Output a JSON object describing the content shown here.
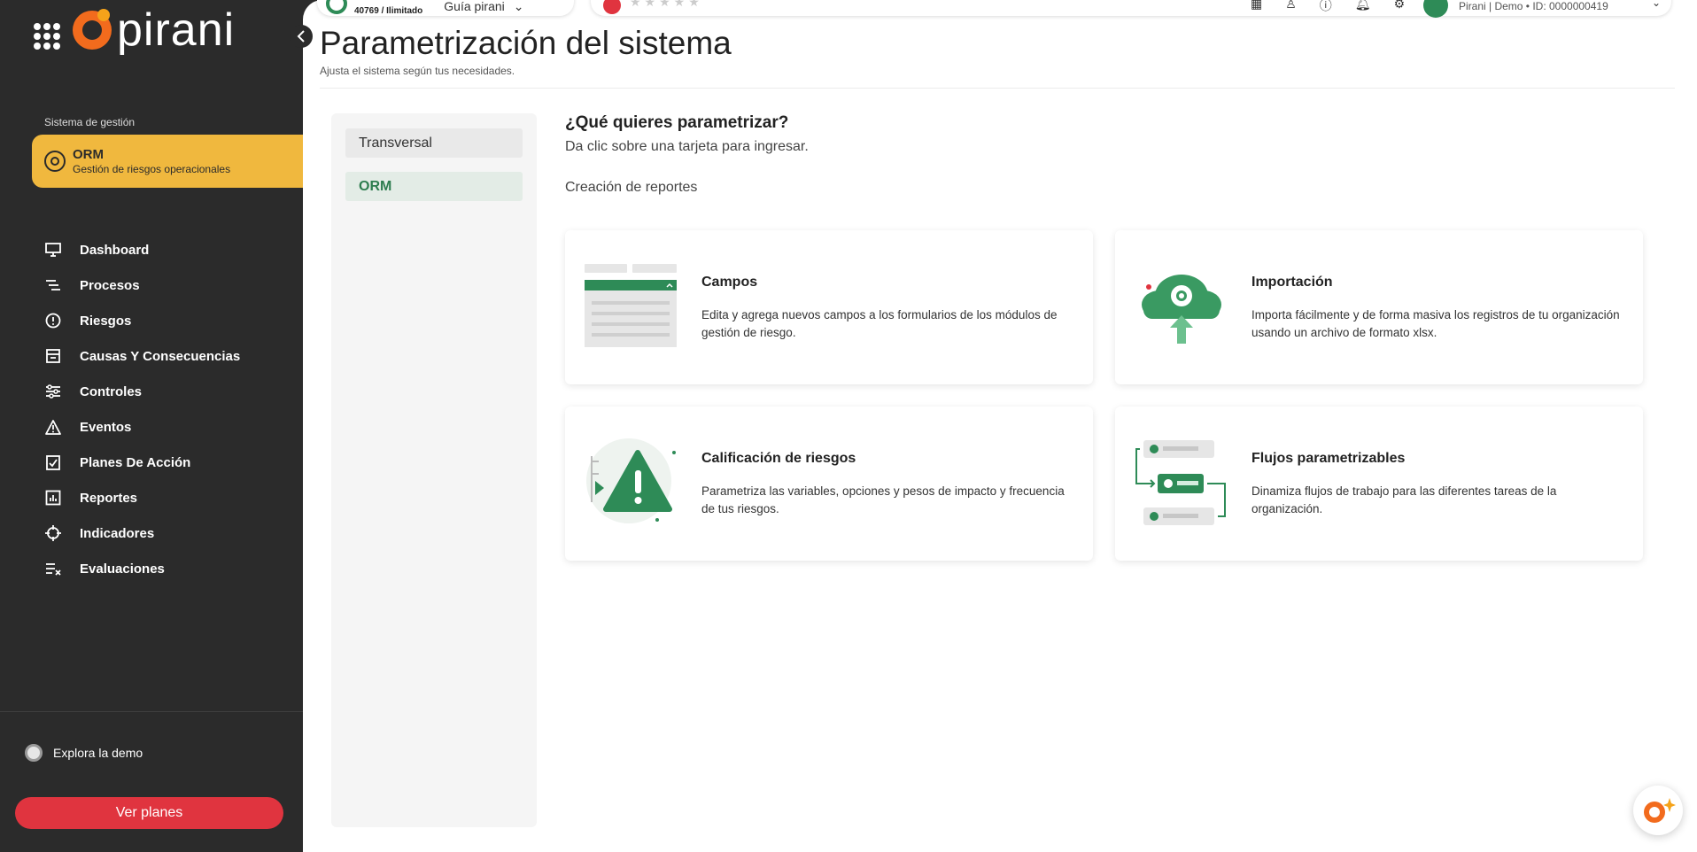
{
  "brand": {
    "name": "pirani"
  },
  "sidebar": {
    "system_label": "Sistema de gestión",
    "module": {
      "title": "ORM",
      "subtitle": "Gestión de riesgos operacionales"
    },
    "items": [
      {
        "label": "Dashboard",
        "icon": "monitor-icon"
      },
      {
        "label": "Procesos",
        "icon": "process-icon"
      },
      {
        "label": "Riesgos",
        "icon": "alert-circle-icon"
      },
      {
        "label": "Causas Y Consecuencias",
        "icon": "cause-icon"
      },
      {
        "label": "Controles",
        "icon": "sliders-icon"
      },
      {
        "label": "Eventos",
        "icon": "warning-triangle-icon"
      },
      {
        "label": "Planes De Acción",
        "icon": "checklist-icon"
      },
      {
        "label": "Reportes",
        "icon": "report-chart-icon"
      },
      {
        "label": "Indicadores",
        "icon": "crosshair-icon"
      },
      {
        "label": "Evaluaciones",
        "icon": "evaluation-icon"
      }
    ],
    "demo_label": "Explora la demo",
    "plans_button": "Ver planes"
  },
  "topbar": {
    "usage": "40769 / Ilimitado",
    "guide": "Guía pirani",
    "user": "Pirani | Demo • ID: 0000000419"
  },
  "page": {
    "title": "Parametrización del sistema",
    "subtitle": "Ajusta el sistema según tus necesidades."
  },
  "tabs": [
    {
      "label": "Transversal",
      "active": false
    },
    {
      "label": "ORM",
      "active": true
    }
  ],
  "content": {
    "question": "¿Qué quieres parametrizar?",
    "question_sub": "Da clic sobre una tarjeta para ingresar.",
    "section_label": "Creación de reportes",
    "cards": [
      {
        "title": "Campos",
        "description": "Edita y agrega nuevos campos a los formularios de los módulos de gestión de riesgo."
      },
      {
        "title": "Importación",
        "description": "Importa fácilmente y de forma masiva los registros de tu organización usando un archivo de formato xlsx."
      },
      {
        "title": "Calificación de riesgos",
        "description": "Parametriza las variables, opciones y pesos de impacto y frecuencia de tus riesgos."
      },
      {
        "title": "Flujos parametrizables",
        "description": "Dinamiza flujos de trabajo para las diferentes tareas de la organización."
      }
    ]
  },
  "colors": {
    "sidebar_bg": "#2b2b2b",
    "module_accent": "#f0b83e",
    "brand_orange": "#f26b1d",
    "green": "#2e8b57",
    "plans_red": "#e0343f"
  }
}
